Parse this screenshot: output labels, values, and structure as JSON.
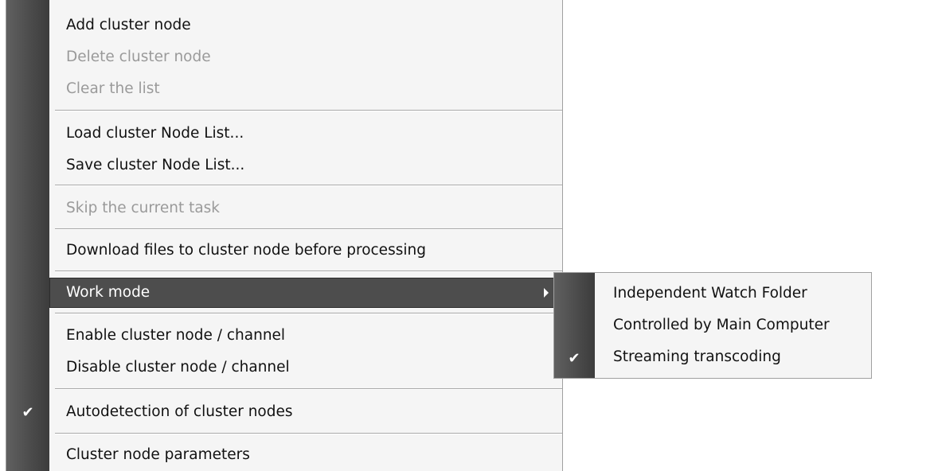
{
  "menu": {
    "items": [
      {
        "label": "Add cluster node",
        "enabled": true
      },
      {
        "label": "Delete cluster node",
        "enabled": false
      },
      {
        "label": "Clear the list",
        "enabled": false
      },
      {
        "label": "Load cluster Node List...",
        "enabled": true
      },
      {
        "label": "Save cluster Node List...",
        "enabled": true
      },
      {
        "label": "Skip the current task",
        "enabled": false
      },
      {
        "label": "Download files to cluster node before processing",
        "enabled": true
      },
      {
        "label": "Work mode",
        "enabled": true,
        "highlighted": true,
        "has_submenu": true
      },
      {
        "label": "Enable cluster node / channel",
        "enabled": true
      },
      {
        "label": "Disable cluster node / channel",
        "enabled": true
      },
      {
        "label": "Autodetection of cluster nodes",
        "enabled": true,
        "checked": true
      },
      {
        "label": "Cluster node parameters",
        "enabled": true
      }
    ],
    "check_glyph": "✔"
  },
  "submenu": {
    "items": [
      {
        "label": "Independent Watch Folder",
        "checked": false
      },
      {
        "label": "Controlled by Main Computer",
        "checked": false
      },
      {
        "label": "Streaming transcoding",
        "checked": true
      }
    ]
  },
  "colors": {
    "menu_bg": "#f5f5f5",
    "gutter": "#4a4a4a",
    "highlight_bg": "#4d4d4d",
    "disabled_text": "#9a9a9a"
  }
}
